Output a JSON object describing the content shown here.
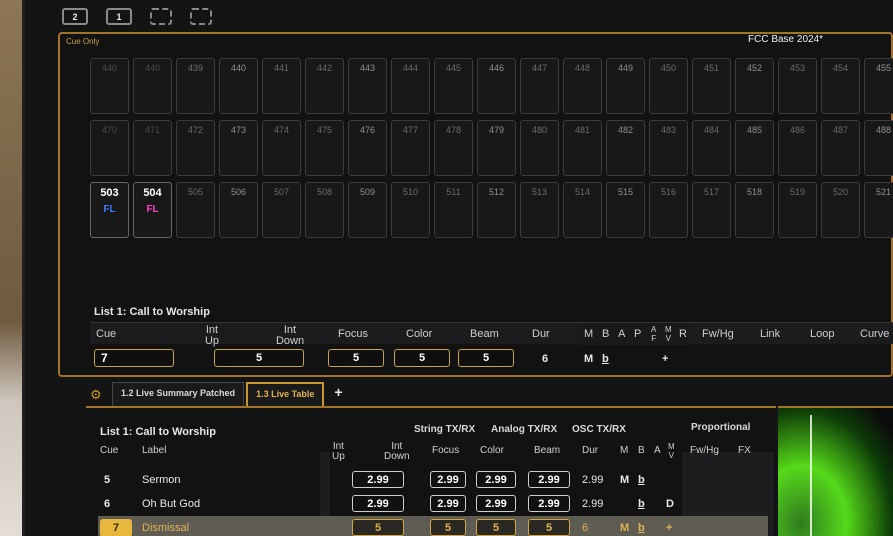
{
  "toolbar": {
    "buttons": [
      "2",
      "1",
      "",
      ""
    ]
  },
  "top": {
    "mode_label": "Cue Only",
    "show_name": "FCC Base 2024*",
    "row1": [
      "440",
      "440",
      "439",
      "440",
      "441",
      "442",
      "443",
      "444",
      "445",
      "446",
      "447",
      "448",
      "449",
      "450",
      "451",
      "452",
      "453",
      "454",
      "455"
    ],
    "row2": [
      "470",
      "471",
      "472",
      "473",
      "474",
      "475",
      "476",
      "477",
      "478",
      "479",
      "480",
      "481",
      "482",
      "483",
      "484",
      "485",
      "486",
      "487",
      "488"
    ],
    "row3": [
      "503",
      "504",
      "505",
      "506",
      "507",
      "508",
      "509",
      "510",
      "511",
      "512",
      "513",
      "514",
      "515",
      "516",
      "517",
      "518",
      "519",
      "520",
      "521"
    ],
    "row3_marks": {
      "503": "FL",
      "504": "FL"
    },
    "list_title": "List 1: Call to Worship",
    "headers": {
      "cue": "Cue",
      "int_up": "Int\nUp",
      "int_down": "Int\nDown",
      "focus": "Focus",
      "color": "Color",
      "beam": "Beam",
      "dur": "Dur",
      "m": "M",
      "b": "B",
      "a": "A",
      "p": "P",
      "afm": "A\nF",
      "mv": "M\nV",
      "r": "R",
      "fw_hg": "Fw/Hg",
      "link": "Link",
      "loop": "Loop",
      "curve": "Curve"
    },
    "values": {
      "cue": "7",
      "int": "5",
      "focus": "5",
      "color": "5",
      "beam": "5",
      "dur": "6",
      "m": "M",
      "b": "b",
      "plus": "+"
    }
  },
  "tabs": [
    {
      "label": "1.2 Live Summary Patched"
    },
    {
      "label": "1.3 Live Table"
    },
    {
      "label": "+"
    }
  ],
  "bottom": {
    "list_title": "List 1: Call to Worship",
    "sub_headers": {
      "string": "String TX/RX",
      "analog": "Analog TX/RX",
      "osc": "OSC TX/RX",
      "proportional": "Proportional"
    },
    "headers": {
      "cue": "Cue",
      "label": "Label",
      "int_up": "Int\nUp",
      "int_down": "Int\nDown",
      "focus": "Focus",
      "color": "Color",
      "beam": "Beam",
      "dur": "Dur",
      "m": "M",
      "b": "B",
      "a": "A",
      "mv": "M\nV",
      "fw_hg": "Fw/Hg",
      "fx": "FX"
    },
    "rows": [
      {
        "cue": "5",
        "label": "Sermon",
        "int": "2.99",
        "focus": "2.99",
        "color": "2.99",
        "beam": "2.99",
        "dur": "2.99",
        "m": "M",
        "b": "b",
        "a": "",
        "mv": ""
      },
      {
        "cue": "6",
        "label": "Oh But God",
        "int": "2.99",
        "focus": "2.99",
        "color": "2.99",
        "beam": "2.99",
        "dur": "2.99",
        "m": "",
        "b": "b",
        "a": "D",
        "mv": ""
      },
      {
        "cue": "7",
        "label": "Dismissal",
        "int": "5",
        "focus": "5",
        "color": "5",
        "beam": "5",
        "dur": "6",
        "m": "M",
        "b": "b",
        "a": "+",
        "mv": ""
      }
    ]
  },
  "colors": {
    "accent": "#c9962f",
    "fl_blue": "#3a7bff",
    "fl_pink": "#ff3fc4",
    "selected_cue": "#e8b73e"
  }
}
